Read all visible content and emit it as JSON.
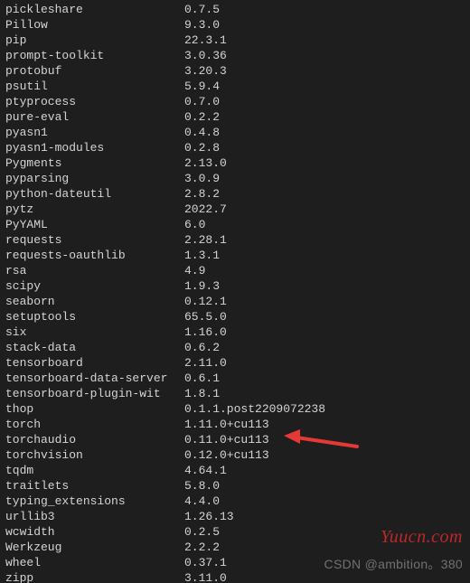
{
  "packages": [
    {
      "name": "pickleshare",
      "version": "0.7.5"
    },
    {
      "name": "Pillow",
      "version": "9.3.0"
    },
    {
      "name": "pip",
      "version": "22.3.1"
    },
    {
      "name": "prompt-toolkit",
      "version": "3.0.36"
    },
    {
      "name": "protobuf",
      "version": "3.20.3"
    },
    {
      "name": "psutil",
      "version": "5.9.4"
    },
    {
      "name": "ptyprocess",
      "version": "0.7.0"
    },
    {
      "name": "pure-eval",
      "version": "0.2.2"
    },
    {
      "name": "pyasn1",
      "version": "0.4.8"
    },
    {
      "name": "pyasn1-modules",
      "version": "0.2.8"
    },
    {
      "name": "Pygments",
      "version": "2.13.0"
    },
    {
      "name": "pyparsing",
      "version": "3.0.9"
    },
    {
      "name": "python-dateutil",
      "version": "2.8.2"
    },
    {
      "name": "pytz",
      "version": "2022.7"
    },
    {
      "name": "PyYAML",
      "version": "6.0"
    },
    {
      "name": "requests",
      "version": "2.28.1"
    },
    {
      "name": "requests-oauthlib",
      "version": "1.3.1"
    },
    {
      "name": "rsa",
      "version": "4.9"
    },
    {
      "name": "scipy",
      "version": "1.9.3"
    },
    {
      "name": "seaborn",
      "version": "0.12.1"
    },
    {
      "name": "setuptools",
      "version": "65.5.0"
    },
    {
      "name": "six",
      "version": "1.16.0"
    },
    {
      "name": "stack-data",
      "version": "0.6.2"
    },
    {
      "name": "tensorboard",
      "version": "2.11.0"
    },
    {
      "name": "tensorboard-data-server",
      "version": "0.6.1"
    },
    {
      "name": "tensorboard-plugin-wit",
      "version": "1.8.1"
    },
    {
      "name": "thop",
      "version": "0.1.1.post2209072238"
    },
    {
      "name": "torch",
      "version": "1.11.0+cu113"
    },
    {
      "name": "torchaudio",
      "version": "0.11.0+cu113"
    },
    {
      "name": "torchvision",
      "version": "0.12.0+cu113"
    },
    {
      "name": "tqdm",
      "version": "4.64.1"
    },
    {
      "name": "traitlets",
      "version": "5.8.0"
    },
    {
      "name": "typing_extensions",
      "version": "4.4.0"
    },
    {
      "name": "urllib3",
      "version": "1.26.13"
    },
    {
      "name": "wcwidth",
      "version": "0.2.5"
    },
    {
      "name": "Werkzeug",
      "version": "2.2.2"
    },
    {
      "name": "wheel",
      "version": "0.37.1"
    },
    {
      "name": "zipp",
      "version": "3.11.0"
    }
  ],
  "highlight_index": 28,
  "watermark_red": "Yuucn.com",
  "watermark_gray": "CSDN @ambition。380"
}
